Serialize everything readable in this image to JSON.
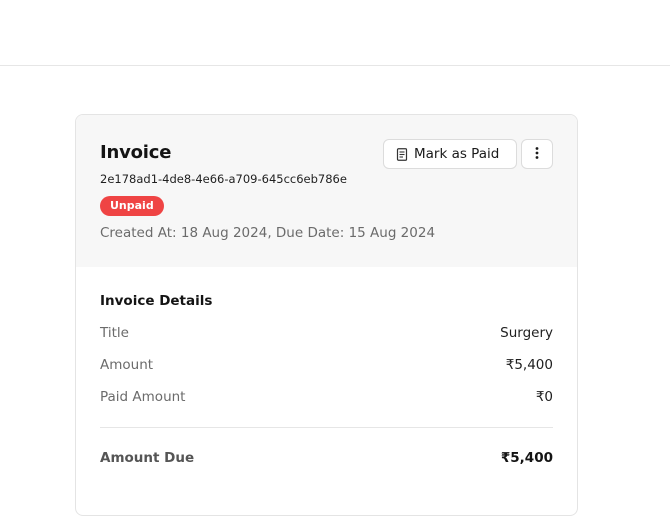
{
  "invoice": {
    "title": "Invoice",
    "id": "2e178ad1-4de8-4e66-a709-645cc6eb786e",
    "status": "Unpaid",
    "dates": "Created At: 18 Aug 2024, Due Date: 15 Aug 2024"
  },
  "actions": {
    "mark_paid_label": "Mark as Paid",
    "more_icon": "kebab-vertical-icon",
    "mark_paid_icon": "document-icon"
  },
  "details": {
    "section_title": "Invoice Details",
    "rows": [
      {
        "label": "Title",
        "value": "Surgery"
      },
      {
        "label": "Amount",
        "value": "₹5,400"
      },
      {
        "label": "Paid Amount",
        "value": "₹0"
      }
    ],
    "total": {
      "label": "Amount Due",
      "value": "₹5,400"
    }
  },
  "colors": {
    "status_unpaid": "#ef4444",
    "header_bg": "#f7f7f7"
  }
}
